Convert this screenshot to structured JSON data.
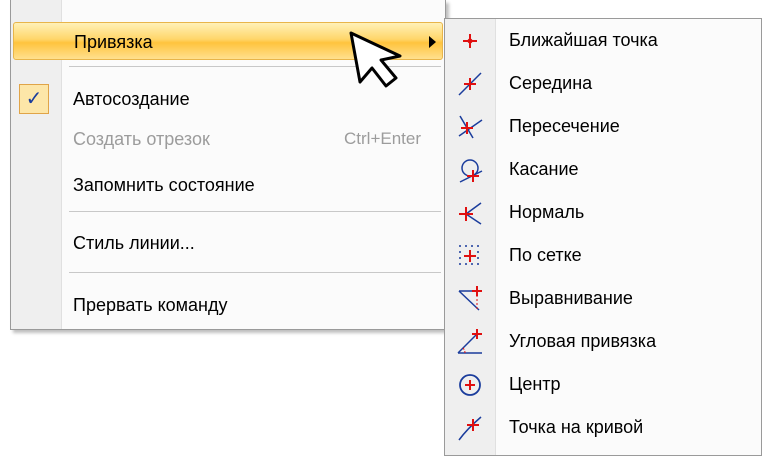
{
  "main_menu": {
    "snap": {
      "label": "Привязка"
    },
    "auto_create": {
      "label": "Автосоздание",
      "check": "✓"
    },
    "create_segment": {
      "label": "Создать отрезок",
      "shortcut": "Ctrl+Enter"
    },
    "remember_state": {
      "label": "Запомнить состояние"
    },
    "line_style": {
      "label": "Стиль линии..."
    },
    "abort_command": {
      "label": "Прервать команду"
    }
  },
  "snap_submenu": {
    "items": [
      {
        "label": "Ближайшая точка",
        "icon": "nearest-point-icon"
      },
      {
        "label": "Середина",
        "icon": "midpoint-icon"
      },
      {
        "label": "Пересечение",
        "icon": "intersection-icon"
      },
      {
        "label": "Касание",
        "icon": "tangent-icon"
      },
      {
        "label": "Нормаль",
        "icon": "normal-icon"
      },
      {
        "label": "По сетке",
        "icon": "grid-snap-icon"
      },
      {
        "label": "Выравнивание",
        "icon": "alignment-icon"
      },
      {
        "label": "Угловая привязка",
        "icon": "angular-snap-icon"
      },
      {
        "label": "Центр",
        "icon": "center-icon"
      },
      {
        "label": "Точка на кривой",
        "icon": "point-on-curve-icon"
      }
    ]
  },
  "colors": {
    "highlight": "#ffc43d",
    "icon_blue": "#1a3c9c",
    "icon_red": "#e01010"
  }
}
